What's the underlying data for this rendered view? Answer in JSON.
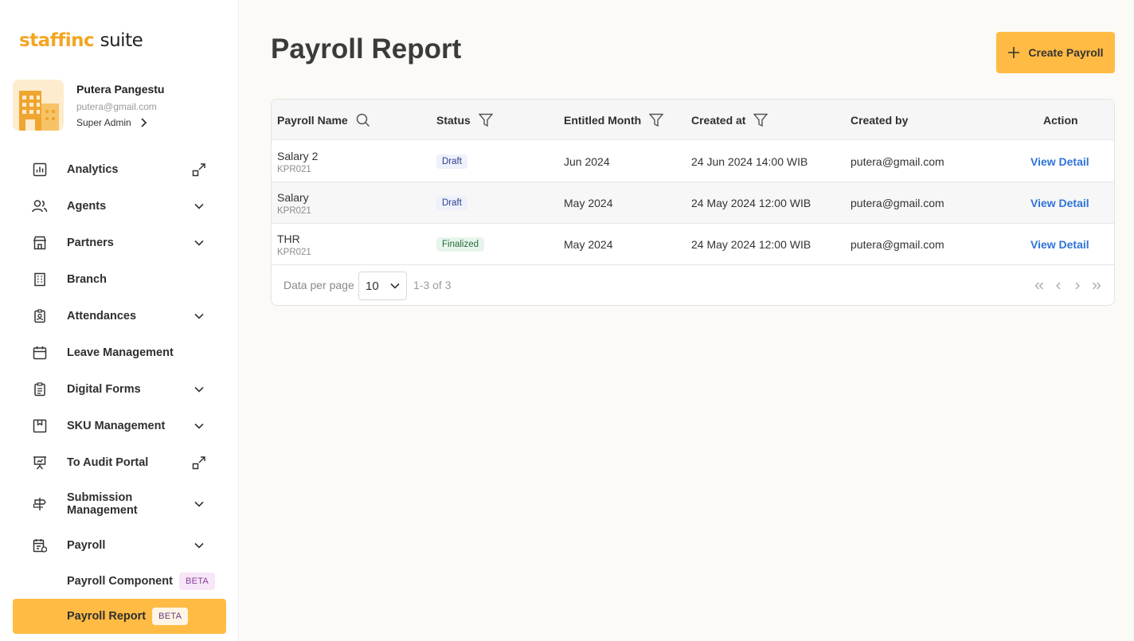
{
  "logo": {
    "brand": "staffinc",
    "suite": "suite"
  },
  "profile": {
    "name": "Putera Pangestu",
    "email": "putera@gmail.com",
    "role": "Super Admin"
  },
  "nav": {
    "analytics": "Analytics",
    "agents": "Agents",
    "partners": "Partners",
    "branch": "Branch",
    "attendances": "Attendances",
    "leave": "Leave Management",
    "forms": "Digital Forms",
    "sku": "SKU Management",
    "audit": "To Audit Portal",
    "submission": "Submission Management",
    "payroll": "Payroll",
    "payroll_component": "Payroll Component",
    "payroll_report": "Payroll Report",
    "beta": "BETA"
  },
  "page": {
    "title": "Payroll Report",
    "create_button": "Create Payroll"
  },
  "table": {
    "headers": {
      "name": "Payroll Name",
      "status": "Status",
      "month": "Entitled Month",
      "created_at": "Created at",
      "created_by": "Created by",
      "action": "Action"
    },
    "rows": [
      {
        "name": "Salary 2",
        "code": "KPR021",
        "status": "Draft",
        "month": "Jun 2024",
        "created_at": "24 Jun 2024 14:00 WIB",
        "created_by": "putera@gmail.com",
        "action": "View Detail"
      },
      {
        "name": "Salary",
        "code": "KPR021",
        "status": "Draft",
        "month": "May 2024",
        "created_at": "24 May 2024 12:00 WIB",
        "created_by": "putera@gmail.com",
        "action": "View Detail"
      },
      {
        "name": "THR",
        "code": "KPR021",
        "status": "Finalized",
        "month": "May 2024",
        "created_at": "24 May 2024 12:00 WIB",
        "created_by": "putera@gmail.com",
        "action": "View Detail"
      }
    ]
  },
  "pagination": {
    "per_page_label": "Data per page",
    "per_page_value": "10",
    "range": "1-3 of 3"
  },
  "colors": {
    "accent": "#ffbb44",
    "link": "#2f73d8",
    "logo": "#f3a521"
  }
}
